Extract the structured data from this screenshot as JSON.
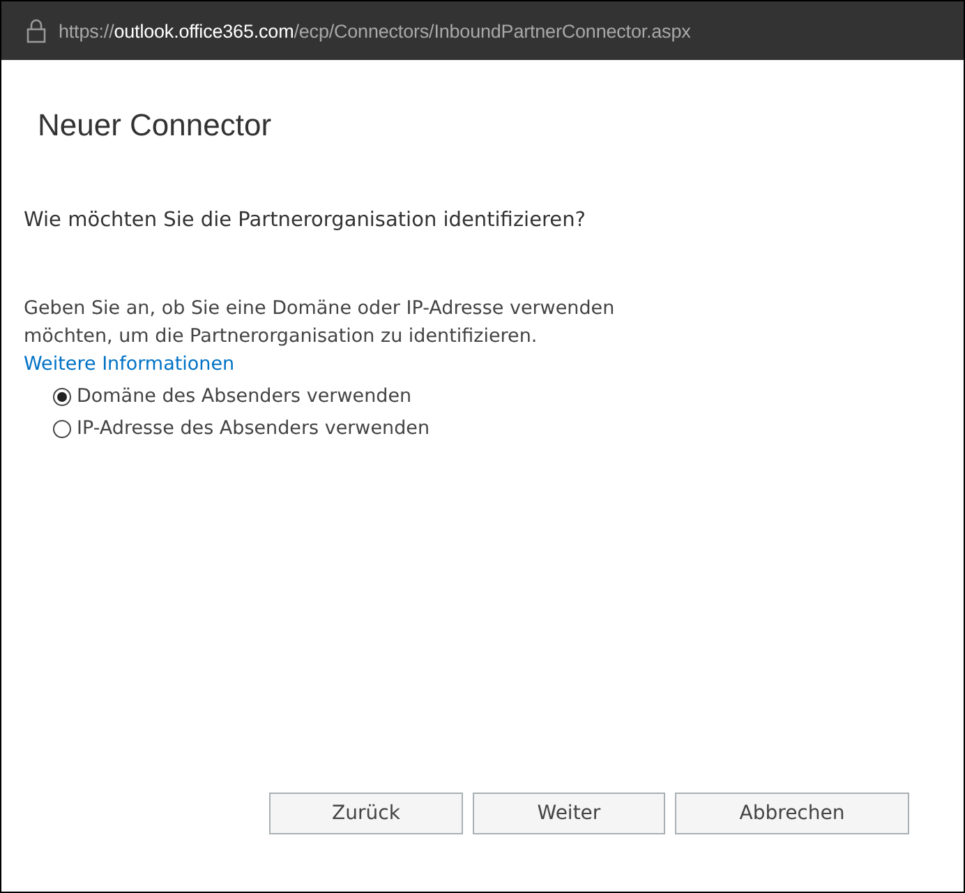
{
  "address_bar": {
    "scheme": "https://",
    "host": "outlook.office365.com",
    "path": "/ecp/Connectors/InboundPartnerConnector.aspx"
  },
  "title": "Neuer Connector",
  "question": "Wie möchten Sie die Partnerorganisation identifizieren?",
  "description": "Geben Sie an, ob Sie eine Domäne oder IP-Adresse verwenden möchten, um die Partnerorganisation zu identifizieren.",
  "link": "Weitere Informationen",
  "options": [
    {
      "label": "Domäne des Absenders verwenden",
      "selected": true
    },
    {
      "label": "IP-Adresse des Absenders verwenden",
      "selected": false
    }
  ],
  "buttons": [
    "Zurück",
    "Weiter",
    "Abbrechen"
  ]
}
